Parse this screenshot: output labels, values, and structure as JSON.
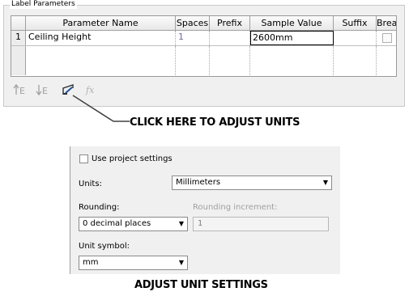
{
  "label_parameters": {
    "title": "Label Parameters",
    "columns": [
      "Parameter Name",
      "Spaces",
      "Prefix",
      "Sample Value",
      "Suffix",
      "Break"
    ],
    "rows": [
      {
        "index": "1",
        "parameter_name": "Ceiling Height",
        "spaces": "1",
        "prefix": "",
        "sample_value": "2600mm",
        "suffix": "",
        "break": false
      }
    ],
    "toolbar_icons": [
      "move-up-icon",
      "move-down-icon",
      "edit-units-icon",
      "formula-icon"
    ]
  },
  "callout": "CLICK HERE TO ADJUST UNITS",
  "unit_settings": {
    "use_project_settings_label": "Use project settings",
    "use_project_settings_checked": false,
    "units_label": "Units:",
    "units_value": "Millimeters",
    "rounding_label": "Rounding:",
    "rounding_value": "0 decimal places",
    "rounding_increment_label": "Rounding increment:",
    "rounding_increment_value": "1",
    "unit_symbol_label": "Unit symbol:",
    "unit_symbol_value": "mm"
  },
  "caption": "ADJUST UNIT SETTINGS"
}
